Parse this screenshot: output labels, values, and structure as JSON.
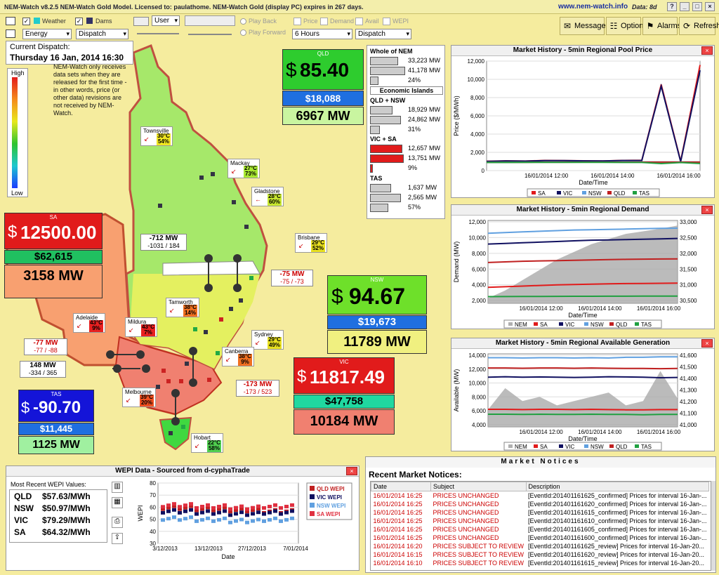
{
  "window": {
    "title": "NEM-Watch v8.2.5 NEM-Watch Gold Model.   Licensed to: paulathome.   NEM-Watch Gold (display PC) expires in 267 days.",
    "url": "www.nem-watch.info",
    "data_label": "Data: 8d"
  },
  "toolbar": {
    "weather_label": "Weather",
    "dams_label": "Dams",
    "weather_checked": "✓",
    "dams_checked": "✓",
    "energy_select": "Energy",
    "dispatch_select": "Dispatch",
    "user_select": "User",
    "play_back": "Play Back",
    "play_forward": "Play Forward",
    "price_label": "Price",
    "demand_label": "Demand",
    "avail_label": "Avail",
    "wepi_label": "WEPI",
    "hours_select": "6 Hours",
    "dispatch_select2": "Dispatch",
    "messages": "Messages",
    "options": "Options",
    "alarms": "Alarms",
    "refresh": "Refresh"
  },
  "dispatch": {
    "label": "Current Dispatch:",
    "datetime": "Thursday 16 Jan, 2014 16:30"
  },
  "note": "NEM-Watch only receives data sets when they are released for the first time - in other words, price (or other data) revisions are not received by NEM-Watch.",
  "legend": {
    "high": "High",
    "low": "Low"
  },
  "regions": {
    "qld": {
      "name": "QLD",
      "price": "$ 85.40",
      "dollar": "$",
      "value": "85.40",
      "fcas": "$18,088",
      "demand": "6967 MW",
      "color": "#2ecc2e"
    },
    "sa": {
      "name": "SA",
      "dollar": "$",
      "value": "12500.00",
      "fcas": "$62,615",
      "demand": "3158 MW",
      "color": "#e11b1b"
    },
    "nsw": {
      "name": "NSW",
      "dollar": "$",
      "value": "94.67",
      "fcas": "$19,673",
      "demand": "11789 MW",
      "color": "#6ee02a"
    },
    "vic": {
      "name": "VIC",
      "dollar": "$",
      "value": "11817.49",
      "fcas": "$47,758",
      "demand": "10184 MW",
      "color": "#e11b1b"
    },
    "tas": {
      "name": "TAS",
      "dollar": "$",
      "value": "-90.70",
      "fcas": "$11,445",
      "demand": "1125 MW",
      "color": "#1414d8"
    }
  },
  "flows": {
    "qni": {
      "main": "-712 MW",
      "sub": "-1031 / 184"
    },
    "dir": {
      "main": "-75 MW",
      "sub": "-75 / -73"
    },
    "heywood": {
      "main": "-77 MW",
      "sub": "-77 / -88"
    },
    "murraylink": {
      "main": "148 MW",
      "sub": "-334 / 365"
    },
    "vicnsw": {
      "main": "-173 MW",
      "sub": "-173 / 523"
    }
  },
  "cities": [
    {
      "name": "Townsville",
      "temp": "30°C",
      "hum": "54%",
      "color": "#f0e620"
    },
    {
      "name": "Mackay",
      "temp": "27°C",
      "hum": "73%",
      "color": "#a8e830"
    },
    {
      "name": "Gladstone",
      "temp": "28°C",
      "hum": "60%",
      "color": "#c8e830"
    },
    {
      "name": "Brisbane",
      "temp": "29°C",
      "hum": "52%",
      "color": "#e8e020"
    },
    {
      "name": "Tamworth",
      "temp": "38°C",
      "hum": "14%",
      "color": "#f07020"
    },
    {
      "name": "Sydney",
      "temp": "29°C",
      "hum": "49%",
      "color": "#e8e020"
    },
    {
      "name": "Canberra",
      "temp": "38°C",
      "hum": "9%",
      "color": "#f07020"
    },
    {
      "name": "Mildura",
      "temp": "43°C",
      "hum": "7%",
      "color": "#e82020"
    },
    {
      "name": "Adelaide",
      "temp": "43°C",
      "hum": "9%",
      "color": "#e82020"
    },
    {
      "name": "Melbourne",
      "temp": "39°C",
      "hum": "20%",
      "color": "#f05020"
    },
    {
      "name": "Hobart",
      "temp": "22°C",
      "hum": "58%",
      "color": "#50d050"
    }
  ],
  "nem_table": {
    "whole_title": "Whole of NEM",
    "whole": [
      "33,223 MW",
      "41,178 MW",
      "24%"
    ],
    "islands_label": "Economic Islands",
    "qldnsw_title": "QLD + NSW",
    "qldnsw": [
      "18,929 MW",
      "24,862 MW",
      "31%"
    ],
    "vicsa_title": "VIC + SA",
    "vicsa": [
      "12,657 MW",
      "13,751 MW",
      "9%"
    ],
    "tas_title": "TAS",
    "tas": [
      "1,637 MW",
      "2,565 MW",
      "57%"
    ]
  },
  "charts": {
    "price": {
      "title": "Market History - 5min Regional Pool Price",
      "ylabel": "Price ($/MWh)",
      "xlabel": "Date/Time",
      "yticks": [
        "12,000",
        "10,000",
        "8,000",
        "6,000",
        "4,000",
        "2,000",
        "0"
      ],
      "xticks": [
        "16/01/2014 12:00",
        "16/01/2014 14:00",
        "16/01/2014 16:00"
      ],
      "legend": [
        "SA",
        "VIC",
        "NSW",
        "QLD",
        "TAS"
      ]
    },
    "demand": {
      "title": "Market History - 5min Regional Demand",
      "ylabel": "Demand (MW)",
      "xlabel": "Date/Time",
      "yticks": [
        "12,000",
        "10,000",
        "8,000",
        "6,000",
        "4,000",
        "2,000"
      ],
      "y2ticks": [
        "33,000",
        "32,500",
        "32,000",
        "31,500",
        "31,000",
        "30,500"
      ],
      "xticks": [
        "16/01/2014 12:00",
        "16/01/2014 14:00",
        "16/01/2014 16:00"
      ],
      "legend": [
        "NEM",
        "SA",
        "VIC",
        "NSW",
        "QLD",
        "TAS"
      ]
    },
    "avail": {
      "title": "Market History - 5min Regional Available Generation",
      "ylabel": "Available (MW)",
      "xlabel": "Date/Time",
      "yticks": [
        "14,000",
        "12,000",
        "10,000",
        "8,000",
        "6,000",
        "4,000"
      ],
      "y2ticks": [
        "41,600",
        "41,500",
        "41,400",
        "41,300",
        "41,200",
        "41,100",
        "41,000"
      ],
      "xticks": [
        "16/01/2014 12:00",
        "16/01/2014 14:00",
        "16/01/2014 16:00"
      ],
      "legend": [
        "NEM",
        "SA",
        "VIC",
        "NSW",
        "QLD",
        "TAS"
      ]
    }
  },
  "chart_data": [
    {
      "type": "line",
      "title": "Market History - 5min Regional Pool Price",
      "ylabel": "Price ($/MWh)",
      "xlabel": "Date/Time",
      "ylim": [
        -1000,
        13000
      ],
      "series": [
        {
          "name": "SA",
          "values": [
            200,
            250,
            220,
            300,
            280,
            260,
            240,
            300,
            320,
            10000,
            200,
            12500
          ]
        },
        {
          "name": "VIC",
          "values": [
            180,
            240,
            210,
            280,
            270,
            250,
            230,
            290,
            300,
            9800,
            150,
            11817
          ]
        },
        {
          "name": "NSW",
          "values": [
            60,
            65,
            70,
            75,
            80,
            85,
            90,
            92,
            94,
            95,
            94,
            95
          ]
        },
        {
          "name": "QLD",
          "values": [
            55,
            60,
            62,
            70,
            72,
            75,
            78,
            80,
            82,
            84,
            85,
            85
          ]
        },
        {
          "name": "TAS",
          "values": [
            40,
            45,
            48,
            50,
            52,
            55,
            50,
            45,
            40,
            -100,
            30,
            -91
          ]
        }
      ]
    },
    {
      "type": "line",
      "title": "Market History - 5min Regional Demand",
      "ylabel": "Demand (MW)",
      "xlabel": "Date/Time",
      "series": [
        {
          "name": "NEM",
          "values": [
            30400,
            30700,
            31100,
            31500,
            31900,
            32200,
            32500,
            32700,
            32900,
            33000,
            33100,
            33223
          ]
        },
        {
          "name": "SA",
          "values": [
            2500,
            2600,
            2700,
            2800,
            2900,
            2950,
            3000,
            3050,
            3100,
            3120,
            3140,
            3158
          ]
        },
        {
          "name": "VIC",
          "values": [
            9300,
            9400,
            9500,
            9600,
            9700,
            9800,
            9900,
            9950,
            10000,
            10050,
            10100,
            10184
          ]
        },
        {
          "name": "NSW",
          "values": [
            11000,
            11100,
            11200,
            11300,
            11400,
            11500,
            11550,
            11600,
            11650,
            11700,
            11750,
            11789
          ]
        },
        {
          "name": "QLD",
          "values": [
            6400,
            6500,
            6600,
            6650,
            6700,
            6750,
            6800,
            6850,
            6900,
            6930,
            6950,
            6967
          ]
        },
        {
          "name": "TAS",
          "values": [
            1050,
            1060,
            1070,
            1080,
            1090,
            1100,
            1105,
            1110,
            1115,
            1120,
            1122,
            1125
          ]
        }
      ]
    },
    {
      "type": "line",
      "title": "Market History - 5min Regional Available Generation",
      "ylabel": "Available (MW)",
      "xlabel": "Date/Time",
      "series": [
        {
          "name": "NEM",
          "values": [
            41050,
            41300,
            41150,
            41200,
            41100,
            41150,
            41200,
            41250,
            41100,
            41150,
            41500,
            41178
          ]
        },
        {
          "name": "SA",
          "values": [
            3600,
            3600,
            3550,
            3600,
            3600,
            3550,
            3600,
            3550,
            3500,
            3500,
            3550,
            3550
          ]
        },
        {
          "name": "VIC",
          "values": [
            10200,
            10300,
            10200,
            10250,
            10200,
            10150,
            10200,
            10300,
            10250,
            10200,
            10100,
            10150
          ]
        },
        {
          "name": "NSW",
          "values": [
            14200,
            14200,
            14150,
            14200,
            14200,
            14150,
            14200,
            14150,
            14300,
            14300,
            14400,
            14400
          ]
        },
        {
          "name": "QLD",
          "values": [
            12100,
            12100,
            12050,
            12100,
            12100,
            12050,
            12100,
            12050,
            12000,
            12000,
            11950,
            12000
          ]
        },
        {
          "name": "TAS",
          "values": [
            2600,
            2600,
            2550,
            2600,
            2550,
            2550,
            2600,
            2550,
            2550,
            2500,
            2550,
            2565
          ]
        }
      ]
    },
    {
      "type": "line",
      "title": "WEPI Data - Sourced from d-cyphaTrade",
      "ylabel": "WEPI",
      "xlabel": "Date",
      "ylim": [
        30,
        80
      ],
      "x": [
        "3/12/2013",
        "13/12/2013",
        "27/12/2013",
        "7/01/2014"
      ],
      "series": [
        {
          "name": "QLD WEPI",
          "values": [
            61,
            60,
            59,
            58,
            57.63
          ]
        },
        {
          "name": "VIC WEPI",
          "values": [
            58,
            57,
            56,
            57,
            79.29
          ]
        },
        {
          "name": "NSW WEPI",
          "values": [
            52,
            51,
            50,
            51,
            50.97
          ]
        },
        {
          "name": "SA WEPI",
          "values": [
            63,
            62,
            61,
            62,
            64.32
          ]
        }
      ]
    }
  ],
  "wepi": {
    "title": "WEPI Data - Sourced from d-cyphaTrade",
    "recent_label": "Most Recent WEPI Values:",
    "values": [
      {
        "region": "QLD",
        "value": "$57.63/MWh"
      },
      {
        "region": "NSW",
        "value": "$50.97/MWh"
      },
      {
        "region": "VIC",
        "value": "$79.29/MWh"
      },
      {
        "region": "SA",
        "value": "$64.32/MWh"
      }
    ],
    "ylabel": "WEPI",
    "xlabel": "Date",
    "yticks": [
      "80",
      "70",
      "60",
      "50",
      "40",
      "30"
    ],
    "xticks": [
      "3/12/2013",
      "13/12/2013",
      "27/12/2013",
      "7/01/2014"
    ],
    "legend": [
      "QLD WEPI",
      "VIC WEPI",
      "NSW WEPI",
      "SA WEPI"
    ]
  },
  "notices": {
    "header": "Market  Notices",
    "title": "Recent Market Notices:",
    "columns": [
      "Date",
      "Subject",
      "Description"
    ],
    "rows": [
      [
        "16/01/2014 16:25",
        "PRICES UNCHANGED",
        "[EventId:201401161625_confirmed] Prices for interval 16-Jan-..."
      ],
      [
        "16/01/2014 16:25",
        "PRICES UNCHANGED",
        "[EventId:201401161620_confirmed] Prices for interval 16-Jan-..."
      ],
      [
        "16/01/2014 16:25",
        "PRICES UNCHANGED",
        "[EventId:201401161615_confirmed] Prices for interval 16-Jan-..."
      ],
      [
        "16/01/2014 16:25",
        "PRICES UNCHANGED",
        "[EventId:201401161610_confirmed] Prices for interval 16-Jan-..."
      ],
      [
        "16/01/2014 16:25",
        "PRICES UNCHANGED",
        "[EventId:201401161605_confirmed] Prices for interval 16-Jan-..."
      ],
      [
        "16/01/2014 16:25",
        "PRICES UNCHANGED",
        "[EventId:201401161600_confirmed] Prices for interval 16-Jan-..."
      ],
      [
        "16/01/2014 16:20",
        "PRICES SUBJECT TO REVIEW",
        "[EventId:201401161625_review] Prices for interval 16-Jan-20..."
      ],
      [
        "16/01/2014 16:15",
        "PRICES SUBJECT TO REVIEW",
        "[EventId:201401161620_review] Prices for interval 16-Jan-20..."
      ],
      [
        "16/01/2014 16:10",
        "PRICES SUBJECT TO REVIEW",
        "[EventId:201401161615_review] Prices for interval 16-Jan-20..."
      ]
    ]
  }
}
